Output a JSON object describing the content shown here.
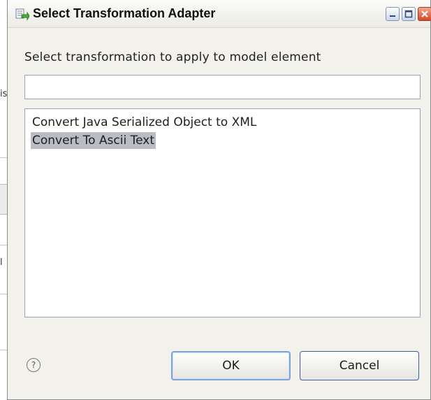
{
  "dialog": {
    "title": "Select Transformation Adapter",
    "prompt": "Select transformation to apply to model element",
    "filter": {
      "value": "",
      "placeholder": ""
    },
    "items": [
      {
        "label": "Convert Java Serialized Object to XML",
        "selected": false
      },
      {
        "label": "Convert To Ascii Text",
        "selected": true
      }
    ],
    "help_glyph": "?",
    "ok_label": "OK",
    "cancel_label": "Cancel"
  },
  "background": {
    "glyph_a": "is",
    "glyph_b": "l"
  },
  "colors": {
    "selection": "#b9bcc2",
    "dialog_bg": "#f2f1ec",
    "close_button": "#d3482a",
    "default_button_border": "#7ea3d8"
  },
  "icons": {
    "title": "transformation-adapter-icon",
    "window_controls": [
      "minimize-icon",
      "maximize-icon",
      "close-icon"
    ],
    "help": "help-icon"
  }
}
